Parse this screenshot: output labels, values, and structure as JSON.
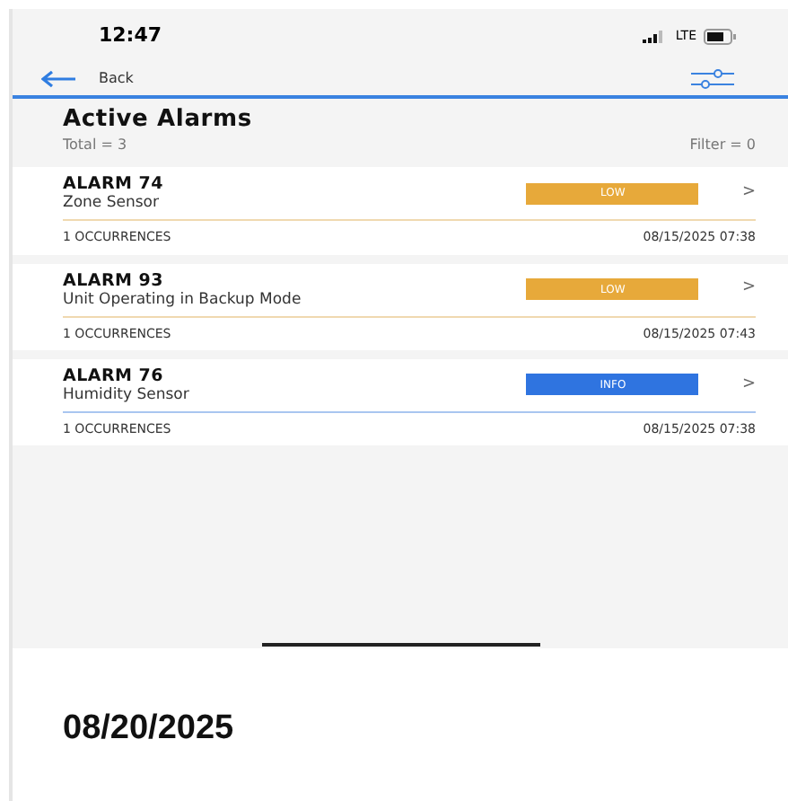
{
  "status_bar": {
    "time": "12:47",
    "network": "LTE"
  },
  "nav": {
    "back_label": "Back"
  },
  "header": {
    "title": "Active Alarms",
    "total": "Total = 3",
    "filter": "Filter = 0"
  },
  "alarms": [
    {
      "name": "ALARM 74",
      "description": "Zone Sensor",
      "severity": "LOW",
      "kind": "low",
      "occurrences": "1 OCCURRENCES",
      "timestamp": "08/15/2025 07:38",
      "chevron": ">"
    },
    {
      "name": "ALARM 93",
      "description": "Unit Operating in Backup Mode",
      "severity": "LOW",
      "kind": "low",
      "occurrences": "1 OCCURRENCES",
      "timestamp": "08/15/2025 07:43",
      "chevron": ">"
    },
    {
      "name": "ALARM 76",
      "description": "Humidity Sensor",
      "severity": "INFO",
      "kind": "info",
      "occurrences": "1 OCCURRENCES",
      "timestamp": "08/15/2025 07:38",
      "chevron": ">"
    }
  ],
  "caption": "08/20/2025"
}
